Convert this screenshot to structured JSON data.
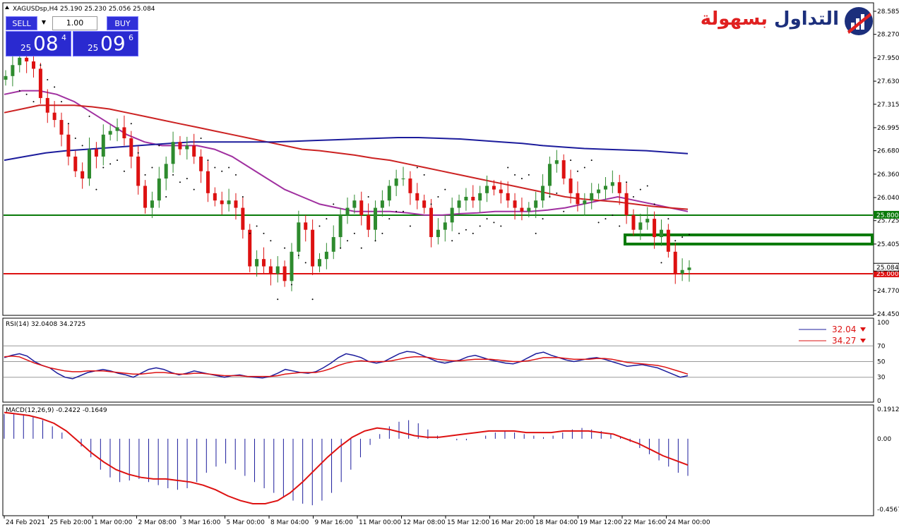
{
  "header": {
    "symbol_info": "XAGUSDsp,H4  25.190 25.230 25.056 25.084"
  },
  "trade_panel": {
    "sell_label": "SELL",
    "buy_label": "BUY",
    "lot_value": "1.00",
    "sell_price_small": "25",
    "sell_price_big": "08",
    "sell_price_sup": "4",
    "buy_price_small": "25",
    "buy_price_big": "09",
    "buy_price_sup": "6"
  },
  "logo": {
    "brand_red": "التداول",
    "brand_blue": "بسهولة",
    "icon": "bar-chart-logo-icon"
  },
  "colors": {
    "bull": "#2e8b2e",
    "bear": "#dd1111",
    "ma_slow": "#1c1c9c",
    "ma_mid": "#cc2222",
    "ma_fast": "#a030a0",
    "support": "#dd1111",
    "resistance": "#0a7a0a"
  },
  "chart_data": [
    {
      "type": "candlestick",
      "title": "XAGUSDsp,H4",
      "ohlc_last": {
        "open": 25.19,
        "high": 25.23,
        "low": 25.056,
        "close": 25.084
      },
      "price_ticks": [
        "28.585",
        "28.270",
        "27.950",
        "27.630",
        "27.315",
        "26.995",
        "26.680",
        "26.360",
        "26.040",
        "25.725",
        "25.405",
        "24.770",
        "24.450"
      ],
      "ylim": [
        24.45,
        28.585
      ],
      "x_ticks": [
        "24 Feb 2021",
        "25 Feb 20:00",
        "1 Mar 00:00",
        "2 Mar 08:00",
        "3 Mar 16:00",
        "5 Mar 00:00",
        "8 Mar 04:00",
        "9 Mar 16:00",
        "11 Mar 00:00",
        "12 Mar 08:00",
        "15 Mar 12:00",
        "16 Mar 20:00",
        "18 Mar 04:00",
        "19 Mar 12:00",
        "22 Mar 16:00",
        "24 Mar 00:00"
      ],
      "close_series": [
        27.7,
        27.85,
        27.95,
        27.9,
        27.8,
        27.4,
        27.2,
        27.1,
        26.9,
        26.6,
        26.4,
        26.3,
        26.7,
        26.6,
        26.9,
        26.95,
        27.0,
        26.85,
        26.6,
        26.2,
        25.9,
        26.0,
        26.3,
        26.5,
        26.8,
        26.7,
        26.75,
        26.6,
        26.4,
        26.1,
        26.0,
        25.95,
        26.0,
        25.9,
        25.6,
        25.1,
        25.2,
        25.1,
        25.0,
        25.1,
        24.9,
        25.3,
        25.7,
        25.6,
        25.1,
        25.2,
        25.3,
        25.5,
        25.8,
        25.9,
        26.0,
        25.8,
        25.6,
        25.9,
        26.0,
        26.2,
        26.3,
        26.3,
        26.1,
        26.0,
        25.9,
        25.5,
        25.6,
        25.7,
        25.9,
        26.0,
        26.05,
        26.0,
        26.1,
        26.2,
        26.15,
        26.1,
        26.0,
        25.9,
        25.85,
        25.9,
        26.0,
        26.2,
        26.5,
        26.55,
        26.3,
        26.1,
        25.95,
        26.0,
        26.1,
        26.15,
        26.2,
        26.25,
        26.1,
        25.8,
        25.6,
        25.7,
        25.75,
        25.5,
        25.6,
        25.3,
        25.0,
        25.05,
        25.084
      ],
      "moving_averages": [
        {
          "values": [
            27.45,
            27.5,
            27.5,
            27.45,
            27.35,
            27.2,
            27.05,
            26.9,
            26.8,
            26.75,
            26.75,
            26.75,
            26.7,
            26.6,
            26.45,
            26.3,
            26.15,
            26.05,
            25.95,
            25.9,
            25.85,
            25.85,
            25.85,
            25.83,
            25.8,
            25.8,
            25.82,
            25.83,
            25.85,
            25.85,
            25.85,
            25.87,
            25.9,
            25.95,
            26.0,
            26.05,
            26.0,
            25.95,
            25.9,
            25.85
          ]
        },
        {
          "values": [
            27.2,
            27.25,
            27.3,
            27.3,
            27.3,
            27.28,
            27.25,
            27.2,
            27.15,
            27.1,
            27.05,
            27.0,
            26.95,
            26.9,
            26.85,
            26.8,
            26.75,
            26.7,
            26.68,
            26.65,
            26.62,
            26.58,
            26.55,
            26.5,
            26.45,
            26.4,
            26.35,
            26.3,
            26.25,
            26.2,
            26.15,
            26.1,
            26.05,
            26.02,
            26.0,
            25.98,
            25.95,
            25.92,
            25.9,
            25.88
          ]
        },
        {
          "values": [
            26.55,
            26.6,
            26.65,
            26.68,
            26.7,
            26.72,
            26.74,
            26.76,
            26.78,
            26.8,
            26.8,
            26.8,
            26.8,
            26.8,
            26.81,
            26.82,
            26.83,
            26.84,
            26.85,
            26.86,
            26.86,
            26.85,
            26.84,
            26.82,
            26.8,
            26.78,
            26.75,
            26.73,
            26.71,
            26.7,
            26.69,
            26.68,
            26.66,
            26.64
          ]
        }
      ],
      "horizontal_levels": [
        {
          "price": 25.8,
          "label": "25.800"
        },
        {
          "price": 25.0,
          "label": "25.000"
        }
      ],
      "current_price_label": "25.084",
      "zone": {
        "from": 25.405,
        "to": 25.53
      }
    },
    {
      "type": "line",
      "title": "RSI(14) 32.0408 34.2725",
      "y_ticks": [
        "100",
        "70",
        "50",
        "30",
        "0"
      ],
      "ylim": [
        0,
        100
      ],
      "levels": [
        70,
        50,
        30
      ],
      "legend": [
        {
          "value": "32.04"
        },
        {
          "value": "34.27"
        }
      ],
      "series": [
        {
          "values": [
            55,
            58,
            60,
            57,
            50,
            45,
            42,
            35,
            30,
            28,
            32,
            36,
            38,
            40,
            38,
            35,
            33,
            30,
            35,
            40,
            42,
            40,
            36,
            33,
            35,
            38,
            36,
            34,
            32,
            30,
            32,
            33,
            31,
            30,
            29,
            31,
            35,
            40,
            38,
            36,
            35,
            37,
            42,
            48,
            55,
            60,
            58,
            55,
            50,
            48,
            50,
            55,
            60,
            63,
            62,
            58,
            54,
            50,
            48,
            50,
            52,
            56,
            58,
            55,
            52,
            50,
            48,
            47,
            50,
            55,
            60,
            62,
            58,
            55,
            52,
            50,
            52,
            54,
            55,
            53,
            50,
            47,
            44,
            45,
            46,
            44,
            42,
            38,
            34,
            30,
            32
          ]
        },
        {
          "values": [
            56,
            57,
            56,
            52,
            48,
            45,
            42,
            40,
            38,
            37,
            37,
            38,
            38,
            38,
            37,
            36,
            35,
            34,
            34,
            35,
            36,
            36,
            35,
            34,
            34,
            35,
            35,
            34,
            33,
            32,
            32,
            32,
            31,
            31,
            31,
            31,
            32,
            34,
            35,
            36,
            36,
            36,
            38,
            41,
            45,
            48,
            50,
            51,
            50,
            50,
            50,
            51,
            53,
            55,
            56,
            56,
            55,
            53,
            52,
            51,
            51,
            52,
            53,
            53,
            53,
            52,
            51,
            50,
            50,
            51,
            53,
            55,
            55,
            55,
            54,
            53,
            53,
            53,
            54,
            54,
            53,
            51,
            49,
            48,
            47,
            46,
            45,
            43,
            40,
            37,
            34
          ]
        }
      ]
    },
    {
      "type": "bar",
      "title": "MACD(12,26,9) -0.2422 -0.1649",
      "y_ticks": [
        "0.1912",
        "0.00",
        "-0.4567"
      ],
      "ylim": [
        -0.4567,
        0.1912
      ],
      "histogram": [
        0.16,
        0.16,
        0.15,
        0.14,
        0.12,
        0.08,
        0.04,
        0.0,
        -0.05,
        -0.12,
        -0.2,
        -0.25,
        -0.28,
        -0.27,
        -0.26,
        -0.28,
        -0.3,
        -0.32,
        -0.33,
        -0.32,
        -0.28,
        -0.22,
        -0.18,
        -0.16,
        -0.2,
        -0.24,
        -0.28,
        -0.32,
        -0.35,
        -0.38,
        -0.4,
        -0.42,
        -0.43,
        -0.4,
        -0.35,
        -0.28,
        -0.2,
        -0.12,
        -0.04,
        0.03,
        0.08,
        0.11,
        0.12,
        0.1,
        0.06,
        0.02,
        0.0,
        -0.01,
        -0.01,
        0.0,
        0.02,
        0.04,
        0.05,
        0.04,
        0.03,
        0.02,
        0.01,
        0.02,
        0.04,
        0.06,
        0.07,
        0.06,
        0.05,
        0.03,
        0.01,
        -0.02,
        -0.06,
        -0.1,
        -0.14,
        -0.18,
        -0.22,
        -0.24
      ],
      "signal": [
        0.17,
        0.16,
        0.15,
        0.13,
        0.1,
        0.05,
        -0.02,
        -0.09,
        -0.15,
        -0.2,
        -0.23,
        -0.25,
        -0.26,
        -0.26,
        -0.27,
        -0.28,
        -0.3,
        -0.33,
        -0.37,
        -0.4,
        -0.42,
        -0.42,
        -0.4,
        -0.35,
        -0.28,
        -0.2,
        -0.12,
        -0.05,
        0.01,
        0.05,
        0.07,
        0.06,
        0.04,
        0.02,
        0.01,
        0.01,
        0.02,
        0.03,
        0.04,
        0.05,
        0.05,
        0.05,
        0.04,
        0.04,
        0.04,
        0.05,
        0.05,
        0.05,
        0.04,
        0.03,
        0.0,
        -0.03,
        -0.07,
        -0.11,
        -0.14,
        -0.17
      ]
    }
  ]
}
